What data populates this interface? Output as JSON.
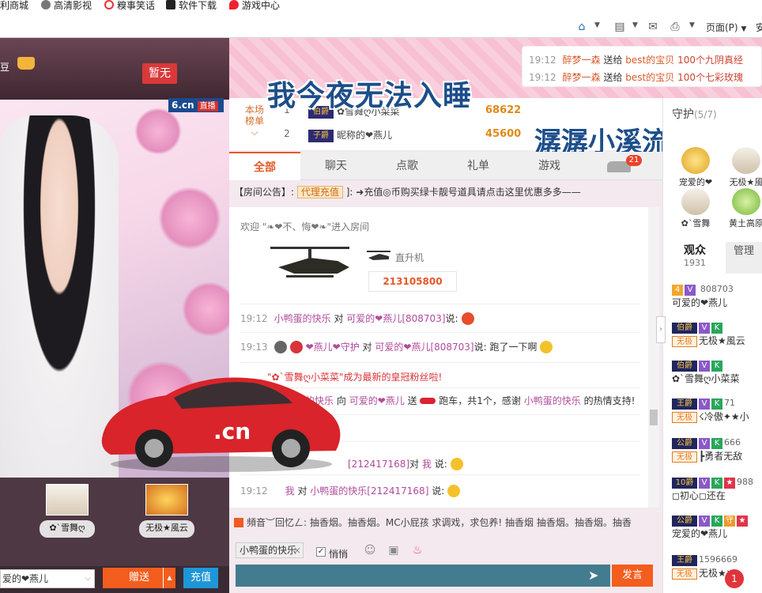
{
  "browser": {
    "favorites": [
      {
        "label": "利商城",
        "icon": "shop-icon"
      },
      {
        "label": "高清影视",
        "icon": "film-icon"
      },
      {
        "label": "糗事笑话",
        "icon": "smile-icon"
      },
      {
        "label": "软件下载",
        "icon": "download-icon"
      },
      {
        "label": "游戏中心",
        "icon": "game-icon"
      }
    ],
    "page_menu": "页面(P)",
    "safety_menu": "安"
  },
  "room": {
    "bean_label": "豆",
    "zanwu_badge": "暂无",
    "logo_text": "6.cn",
    "live_badge": "直播",
    "overlay_title": "我今夜无法入睡",
    "overlay_song": "潺潺小溪流水"
  },
  "gift_ticker": [
    {
      "time": "19:12",
      "user": "醉梦一森",
      "action": "送给",
      "to": "best的宝贝",
      "gift": "100个九阴真经"
    },
    {
      "time": "19:12",
      "user": "醉梦一森",
      "action": "送给",
      "to": "best的宝贝",
      "gift": "100个七彩玫瑰"
    }
  ],
  "ranking": {
    "tag_line1": "本场",
    "tag_line2": "榜单",
    "rows": [
      {
        "no": "1",
        "level": "伯爵",
        "name": "✿雪舞ღ小菜菜",
        "value": "68622"
      },
      {
        "no": "2",
        "level": "子爵",
        "name": "昵称的❤燕儿",
        "value": "45600"
      }
    ]
  },
  "tabs": [
    "全部",
    "聊天",
    "点歌",
    "礼单",
    "游戏"
  ],
  "car_count": "21",
  "notice": {
    "prefix": "【房间公告】:",
    "charge_label": "代理充值",
    "text": "]: ➜充值◎币购买绿卡靓号道具请点击这里优惠多多——"
  },
  "chat": {
    "welcome": "欢迎 \"❧❤不、悔❤❧\"进入房间",
    "heli_name": "直升机",
    "heli_id": "213105800",
    "messages": [
      {
        "time": "19:12",
        "user": "小鸭蛋的快乐",
        "mid": "对",
        "target": "可爱的❤燕儿[808703]",
        "tail": "说:"
      },
      {
        "time": "19:13",
        "user": "❤燕儿❤守护",
        "mid": "对",
        "target": "可爱的❤燕儿[808703]",
        "tail": "说: 跑了一下啊"
      }
    ],
    "fan_msg": "\"✿`雪舞ღ小菜菜\"成为最新的皇冠粉丝啦!",
    "gift_msg_a": "的快乐",
    "gift_msg_b": "向",
    "gift_msg_c": "可爱的❤燕儿",
    "gift_msg_d": "送",
    "gift_msg_e": "跑车，共1个，感谢",
    "gift_msg_f": "小鸭蛋的快乐",
    "gift_msg_g": "的热情支持!",
    "reply1_id": "[212417168]",
    "reply1_mid": "对",
    "reply1_me": "我",
    "reply1_tail": "说:",
    "reply2_time": "19:12",
    "reply2_me": "我",
    "reply2_mid": "对",
    "reply2_user": "小鸭蛋的快乐",
    "reply2_id": "[212417168]",
    "reply2_tail": "说:"
  },
  "marquee": "頻音︶回忆ㄥ: 抽香烟。抽香烟。MC小屁孩 求调戏，求包养! 抽香烟 抽香烟。抽香烟。抽香",
  "input": {
    "target": "小鸭蛋的快乐",
    "whisper": "悄悄",
    "send": "发言"
  },
  "gift_bar": {
    "recipient": "爱的❤燕儿",
    "send_gift": "赠送",
    "recharge": "充值"
  },
  "guard_cards_left": [
    {
      "name": "✿`雪舞ღ"
    },
    {
      "name": "无极★風云"
    }
  ],
  "right_panel": {
    "guard_title": "守护",
    "guard_count": "(5/7)",
    "guards": [
      {
        "name": "宠爱的❤"
      },
      {
        "name": "无极★風"
      },
      {
        "name": "✿`雪舞"
      },
      {
        "name": "黄土高原"
      }
    ],
    "viewers_label": "观众",
    "viewers_count": "1931",
    "manager_label": "管理",
    "viewers": [
      {
        "id": "808703",
        "name": "可爱的❤燕儿",
        "level": "4",
        "noble": ""
      },
      {
        "id": "",
        "name": "无极★風云",
        "level": "伯爵",
        "noble": "无极"
      },
      {
        "id": "",
        "name": "✿`雪舞ღ小菜菜",
        "level": "伯爵",
        "noble": ""
      },
      {
        "id": "71",
        "name": "☇冷傲✦★小",
        "level": "王爵",
        "noble": "无极"
      },
      {
        "id": "666",
        "name": "┣勇者无敌",
        "level": "公爵",
        "noble": "无极"
      },
      {
        "id": "988",
        "name": "◻初心◻还在",
        "level": "10爵",
        "noble": ""
      },
      {
        "id": "",
        "name": "宠爱的❤燕儿",
        "level": "公爵",
        "noble": ""
      },
      {
        "id": "1596669",
        "name": "无极★氺",
        "level": "王爵",
        "noble": "无极"
      }
    ],
    "notification_count": "1"
  },
  "colors": {
    "accent": "#f35d1e",
    "brand": "#1a4a8e",
    "pink_band": "#f7c0d3",
    "input_bg": "#437c8f"
  }
}
